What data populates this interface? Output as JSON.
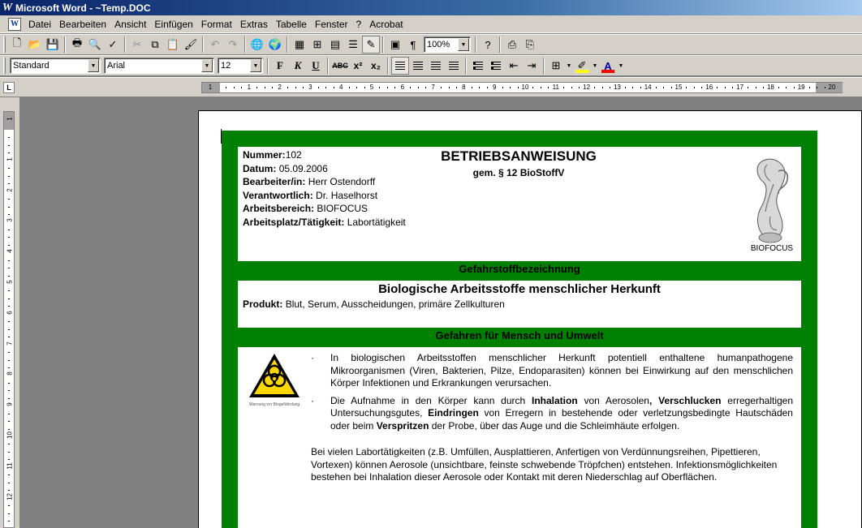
{
  "window": {
    "title": "Microsoft Word - ~Temp.DOC"
  },
  "menu": [
    "Datei",
    "Bearbeiten",
    "Ansicht",
    "Einfügen",
    "Format",
    "Extras",
    "Tabelle",
    "Fenster",
    "?",
    "Acrobat"
  ],
  "toolbar": {
    "zoom": "100%",
    "style": "Standard",
    "font": "Arial",
    "size": "12"
  },
  "ruler": {
    "h_ticks": [
      "1",
      "1",
      "2",
      "3",
      "4",
      "5",
      "6",
      "7",
      "8",
      "9",
      "10",
      "11",
      "12",
      "13",
      "14",
      "15",
      "16",
      "17",
      "18",
      "19",
      "20"
    ],
    "v_ticks": [
      "1",
      "1",
      "2",
      "3",
      "4",
      "5",
      "6",
      "7",
      "8",
      "9",
      "10",
      "11",
      "12"
    ]
  },
  "doc": {
    "header": {
      "nummer_label": "Nummer:",
      "nummer": "102",
      "datum_label": "Datum:",
      "datum": "05.09.2006",
      "bearbeiter_label": "Bearbeiter/in:",
      "bearbeiter": "Herr Ostendorff",
      "verantwortlich_label": "Verantwortlich:",
      "verantwortlich": "Dr. Haselhorst",
      "bereich_label": "Arbeitsbereich:",
      "bereich": "BIOFOCUS",
      "platz_label": "Arbeitsplatz/Tätigkeit:",
      "platz": "Labortätigkeit",
      "title": "BETRIEBSANWEISUNG",
      "subtitle": "gem. § 12 BioStoffV",
      "logo_label": "BIOFOCUS"
    },
    "section1_title": "Gefahrstoffbezeichnung",
    "product": {
      "title": "Biologische Arbeitsstoffe menschlicher Herkunft",
      "label": "Produkt:",
      "value": "Blut, Serum, Ausscheidungen, primäre Zellkulturen"
    },
    "section2_title": "Gefahren für Mensch und Umwelt",
    "hazard": {
      "sign_caption": "Warnung vor Biogefährdung",
      "bullet1": "In biologischen Arbeitsstoffen menschlicher Herkunft potentiell enthaltene humanpathogene Mikroorganismen (Viren, Bakterien, Pilze, Endoparasiten) können bei Einwirkung auf den menschlichen Körper Infektionen und Erkrankungen verursachen.",
      "b2_a": "Die Aufnahme in den Körper kann durch ",
      "b2_b": "Inhalation",
      "b2_c": " von Aerosolen",
      "b2_d": ", Verschlucken",
      "b2_e": " erregerhaltigen Untersuchungsgutes, ",
      "b2_f": "Eindringen",
      "b2_g": " von Erregern in bestehende oder verletzungsbedingte Hautschäden oder beim ",
      "b2_h": "Verspritzen",
      "b2_i": " der Probe, über das Auge und die Schleimhäute erfolgen.",
      "paragraph": "Bei vielen Labortätigkeiten (z.B. Umfüllen, Ausplattieren, Anfertigen von Verdünnungsreihen, Pipettieren, Vortexen) können Aerosole (unsichtbare, feinste schwebende Tröpfchen) entstehen. Infektionsmöglichkeiten bestehen bei Inhalation dieser Aerosole oder Kontakt mit deren Niederschlag auf Oberflächen."
    }
  }
}
